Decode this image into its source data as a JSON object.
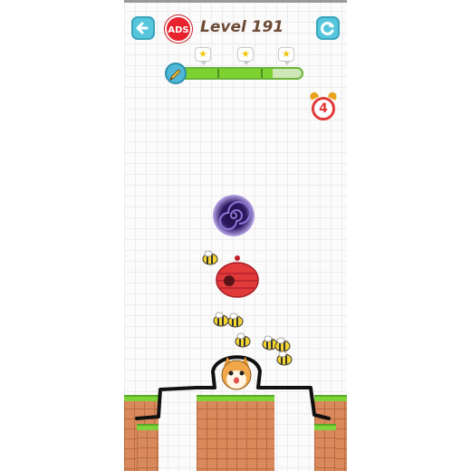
{
  "header": {
    "ads_label": "ADS",
    "level_label": "Level 191"
  },
  "progress": {
    "stars": [
      "★",
      "★",
      "★"
    ],
    "fill_fraction": 0.78
  },
  "timer": {
    "value": "4"
  },
  "icons": {
    "back": "back-arrow-icon",
    "restart": "restart-icon",
    "pencil": "pencil-icon",
    "alarm": "alarm-clock-icon"
  },
  "colors": {
    "accent": "#56c6dd",
    "ads_red": "#e8232d",
    "level_text": "#6d4a35",
    "progress_green": "#7ed22f",
    "timer_red": "#e23a3a",
    "grass": "#7fd33a",
    "dirt": "#d9895b"
  }
}
